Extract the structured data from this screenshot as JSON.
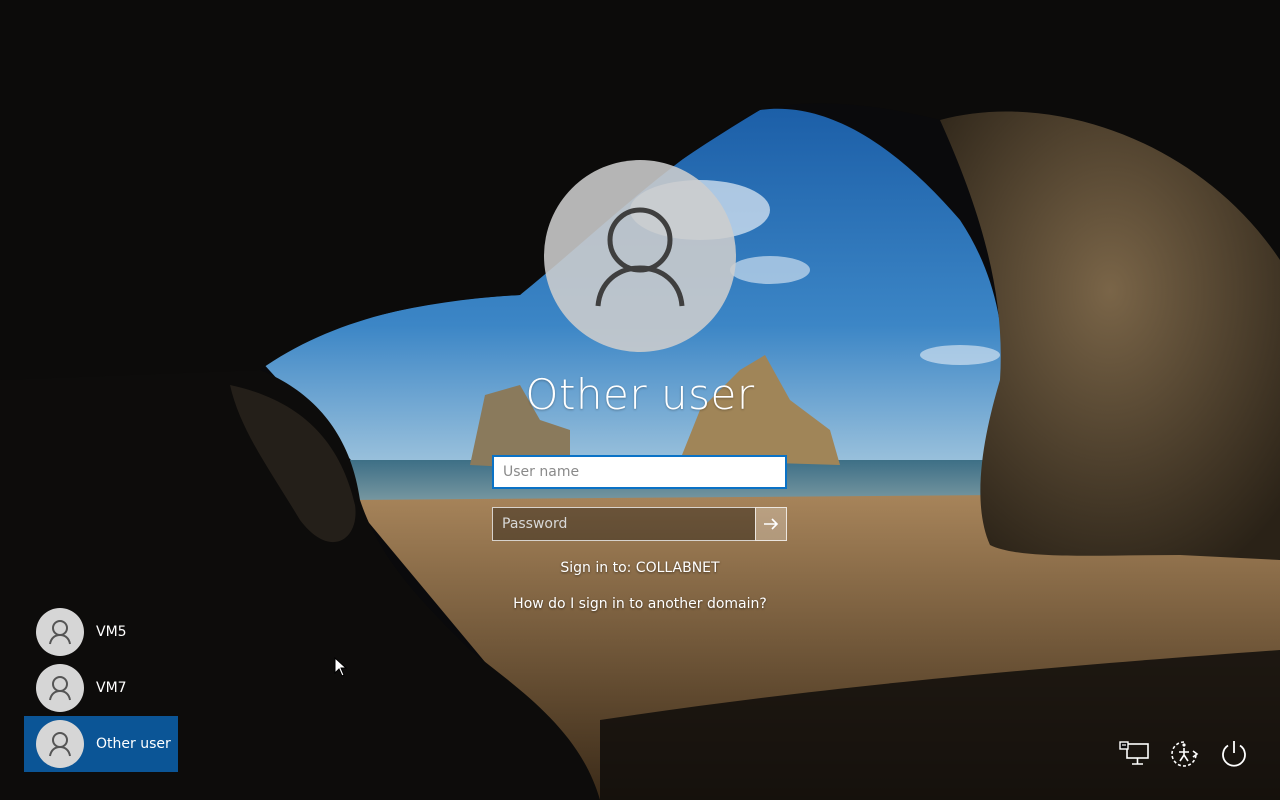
{
  "login": {
    "title": "Other user",
    "username_placeholder": "User name",
    "password_placeholder": "Password",
    "sign_in_to": "Sign in to: COLLABNET",
    "other_domain_link": "How do I sign in to another domain?"
  },
  "users": [
    {
      "label": "VM5",
      "selected": false
    },
    {
      "label": "VM7",
      "selected": false
    },
    {
      "label": "Other user",
      "selected": true
    }
  ],
  "system_icons": [
    "network-icon",
    "ease-of-access-icon",
    "power-icon"
  ],
  "colors": {
    "accent": "#0a72c6",
    "selected_tile": "#0b5596"
  }
}
